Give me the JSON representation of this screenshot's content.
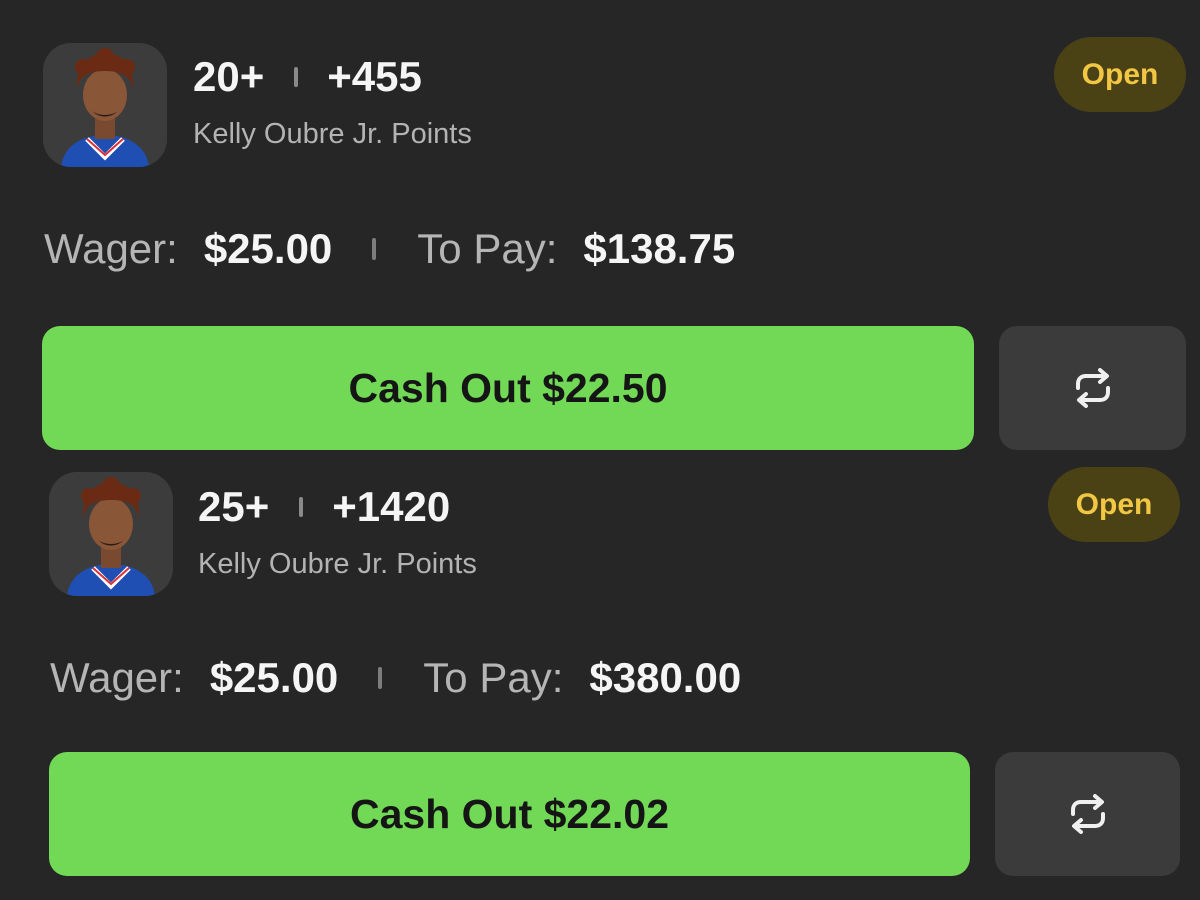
{
  "bets": [
    {
      "line": "20+",
      "odds": "+455",
      "market": "Kelly Oubre Jr. Points",
      "status": "Open",
      "wager_label": "Wager:",
      "wager": "$25.00",
      "to_pay_label": "To Pay:",
      "to_pay": "$138.75",
      "cash_out_label": "Cash Out $22.50",
      "avatar_icon": "player-headshot",
      "refresh_icon": "repeat-icon"
    },
    {
      "line": "25+",
      "odds": "+1420",
      "market": "Kelly Oubre Jr. Points",
      "status": "Open",
      "wager_label": "Wager:",
      "wager": "$25.00",
      "to_pay_label": "To Pay:",
      "to_pay": "$380.00",
      "cash_out_label": "Cash Out $22.02",
      "avatar_icon": "player-headshot",
      "refresh_icon": "repeat-icon"
    }
  ],
  "colors": {
    "background": "#262626",
    "cash_out_green": "#72d957",
    "badge_bg": "#4a4215",
    "badge_text": "#f2c744",
    "refresh_bg": "#3b3b3b"
  }
}
